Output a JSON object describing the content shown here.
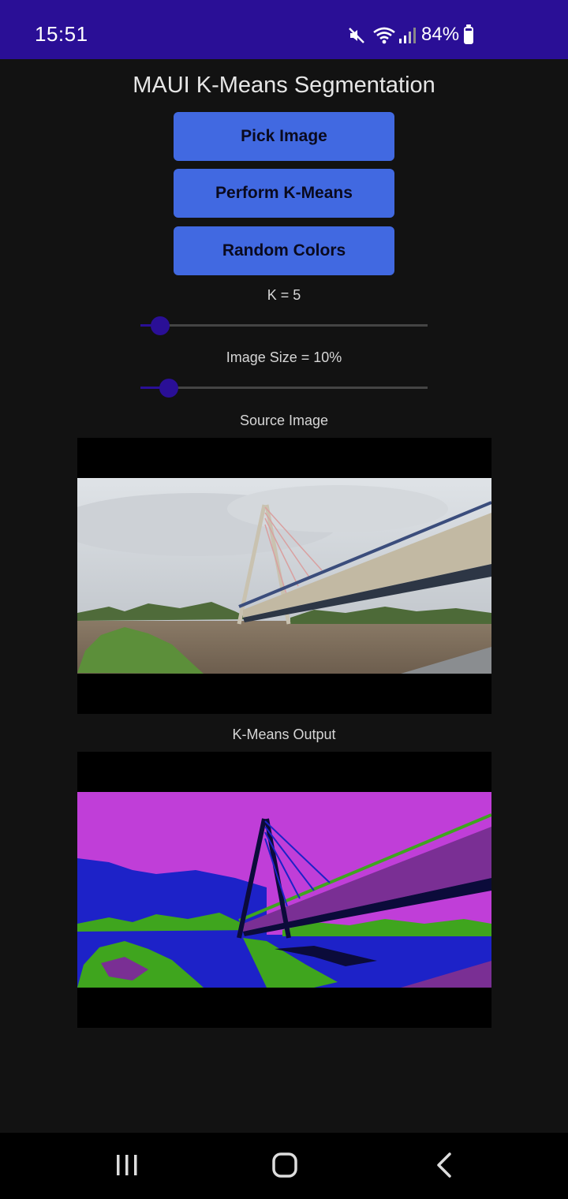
{
  "status_bar": {
    "time": "15:51",
    "battery": "84%",
    "battery_level": 0.84,
    "icons": [
      "mute-icon",
      "wifi-icon",
      "signal-icon",
      "battery-icon"
    ]
  },
  "app": {
    "title": "MAUI K-Means Segmentation",
    "buttons": {
      "pick": "Pick Image",
      "perform": "Perform K-Means",
      "random": "Random Colors"
    },
    "k_slider": {
      "label": "K = 5",
      "value": 5,
      "fraction": 0.07
    },
    "size_slider": {
      "label": "Image Size = 10%",
      "value": 10,
      "fraction": 0.1
    },
    "source_label": "Source Image",
    "output_label": "K-Means Output",
    "palette": {
      "accent": "#4169e1",
      "brand": "#2a0f96",
      "cluster_purple": "#c03ed8",
      "cluster_blue": "#1d22c8",
      "cluster_green": "#3fa51e",
      "cluster_dark": "#0b0b3a",
      "cluster_violet": "#7a2f94"
    }
  },
  "nav": [
    "recent-apps-icon",
    "home-icon",
    "back-icon"
  ]
}
